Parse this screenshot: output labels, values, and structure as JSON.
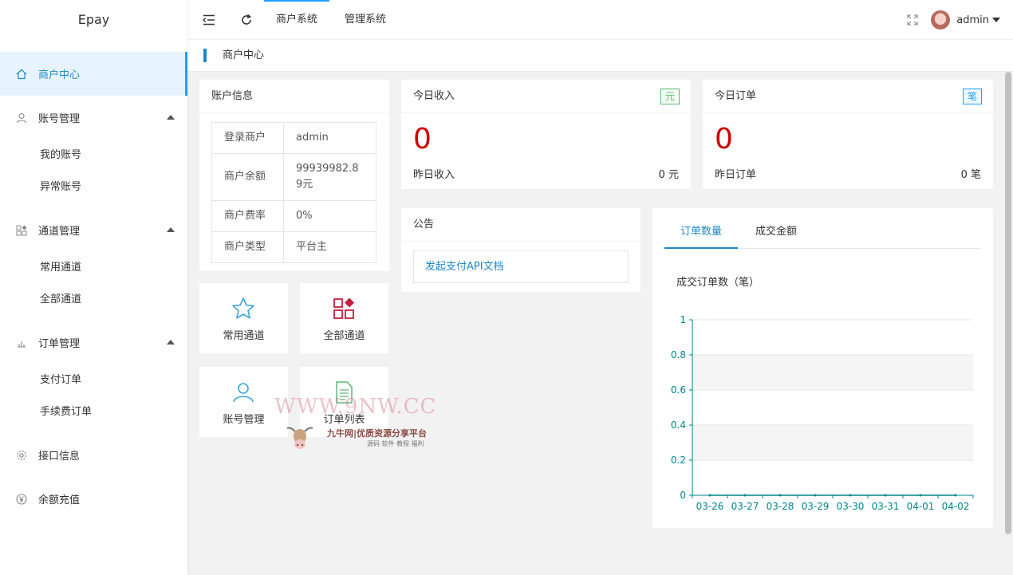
{
  "app": {
    "logo": "Epay"
  },
  "sidebar": {
    "items": [
      {
        "label": "商户中心",
        "icon": "home-icon",
        "active": true
      },
      {
        "label": "账号管理",
        "icon": "user-icon",
        "children": [
          "我的账号",
          "异常账号"
        ]
      },
      {
        "label": "通道管理",
        "icon": "apps-icon",
        "children": [
          "常用通道",
          "全部通道"
        ]
      },
      {
        "label": "订单管理",
        "icon": "chart-icon",
        "children": [
          "支付订单",
          "手续费订单"
        ]
      },
      {
        "label": "接口信息",
        "icon": "gear-icon"
      },
      {
        "label": "余额充值",
        "icon": "yen-icon"
      }
    ]
  },
  "header": {
    "tabs": [
      "商户系统",
      "管理系统"
    ],
    "active_tab": 0,
    "user": "admin"
  },
  "breadcrumb": "商户中心",
  "account": {
    "title": "账户信息",
    "rows": [
      {
        "k": "登录商户",
        "v": "admin"
      },
      {
        "k": "商户余额",
        "v": "99939982.89元"
      },
      {
        "k": "商户费率",
        "v": "0%"
      },
      {
        "k": "商户类型",
        "v": "平台主"
      }
    ]
  },
  "income": {
    "title": "今日收入",
    "badge": "元",
    "value": "0",
    "sub_label": "昨日收入",
    "sub_value": "0 元",
    "badge_color": "#5fb878"
  },
  "orders": {
    "title": "今日订单",
    "badge": "笔",
    "value": "0",
    "sub_label": "昨日订单",
    "sub_value": "0 笔",
    "badge_color": "#1e9fff"
  },
  "shortcuts": [
    {
      "label": "常用通道",
      "icon": "star-icon"
    },
    {
      "label": "全部通道",
      "icon": "apps-icon"
    },
    {
      "label": "账号管理",
      "icon": "user-icon"
    },
    {
      "label": "订单列表",
      "icon": "document-icon"
    }
  ],
  "notice": {
    "title": "公告",
    "link": "发起支付API文档"
  },
  "stats": {
    "tabs": [
      "订单数量",
      "成交金额"
    ],
    "active_tab": 0,
    "chart_title": "成交订单数（笔）"
  },
  "chart_data": {
    "type": "line",
    "title": "成交订单数（笔）",
    "categories": [
      "03-26",
      "03-27",
      "03-28",
      "03-29",
      "03-30",
      "03-31",
      "04-01",
      "04-02"
    ],
    "values": [
      0,
      0,
      0,
      0,
      0,
      0,
      0,
      0
    ],
    "yticks": [
      "0",
      "0.2",
      "0.4",
      "0.6",
      "0.8",
      "1"
    ],
    "ylim": [
      0,
      1
    ],
    "grid": true,
    "axis_color": "#00858a"
  },
  "watermark": {
    "text": "WWW.9NW.CC",
    "brand": "九牛网|优质资源分享平台",
    "tagline": "源码 软件 教程 福利"
  }
}
